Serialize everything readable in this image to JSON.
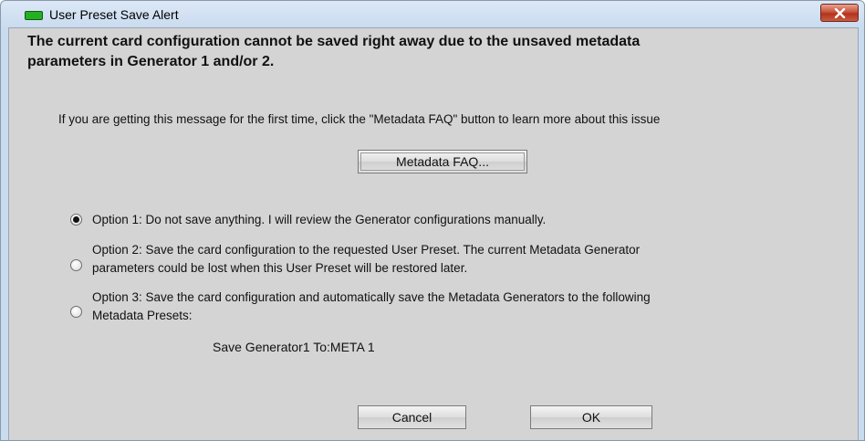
{
  "window": {
    "title": "User Preset Save Alert",
    "icon": "green-led-icon",
    "close_icon": "close-icon"
  },
  "message": {
    "headline_line1": "The current card configuration cannot be saved right away due to the unsaved metadata",
    "headline_line2": "parameters in Generator 1 and/or 2.",
    "info": "If you are getting this message for the first time, click the \"Metadata FAQ\" button to learn more about this issue"
  },
  "buttons": {
    "faq_label": "Metadata FAQ...",
    "cancel_label": "Cancel",
    "ok_label": "OK"
  },
  "options": [
    {
      "selected": true,
      "line1": "Option 1: Do not save anything. I will review the Generator configurations manually.",
      "line2": ""
    },
    {
      "selected": false,
      "line1": "Option 2: Save the card configuration to the requested User Preset. The current Metadata Generator",
      "line2": "parameters could be lost when this User Preset will be restored later."
    },
    {
      "selected": false,
      "line1": "Option 3: Save the card configuration and automatically save the Metadata Generators to the following",
      "line2": "Metadata Presets:"
    }
  ],
  "generator_line": "Save Generator1 To:META 1",
  "colors": {
    "close_button": "#c8523b",
    "title_icon": "#25b024",
    "dialog_background": "#d4d4d4"
  }
}
